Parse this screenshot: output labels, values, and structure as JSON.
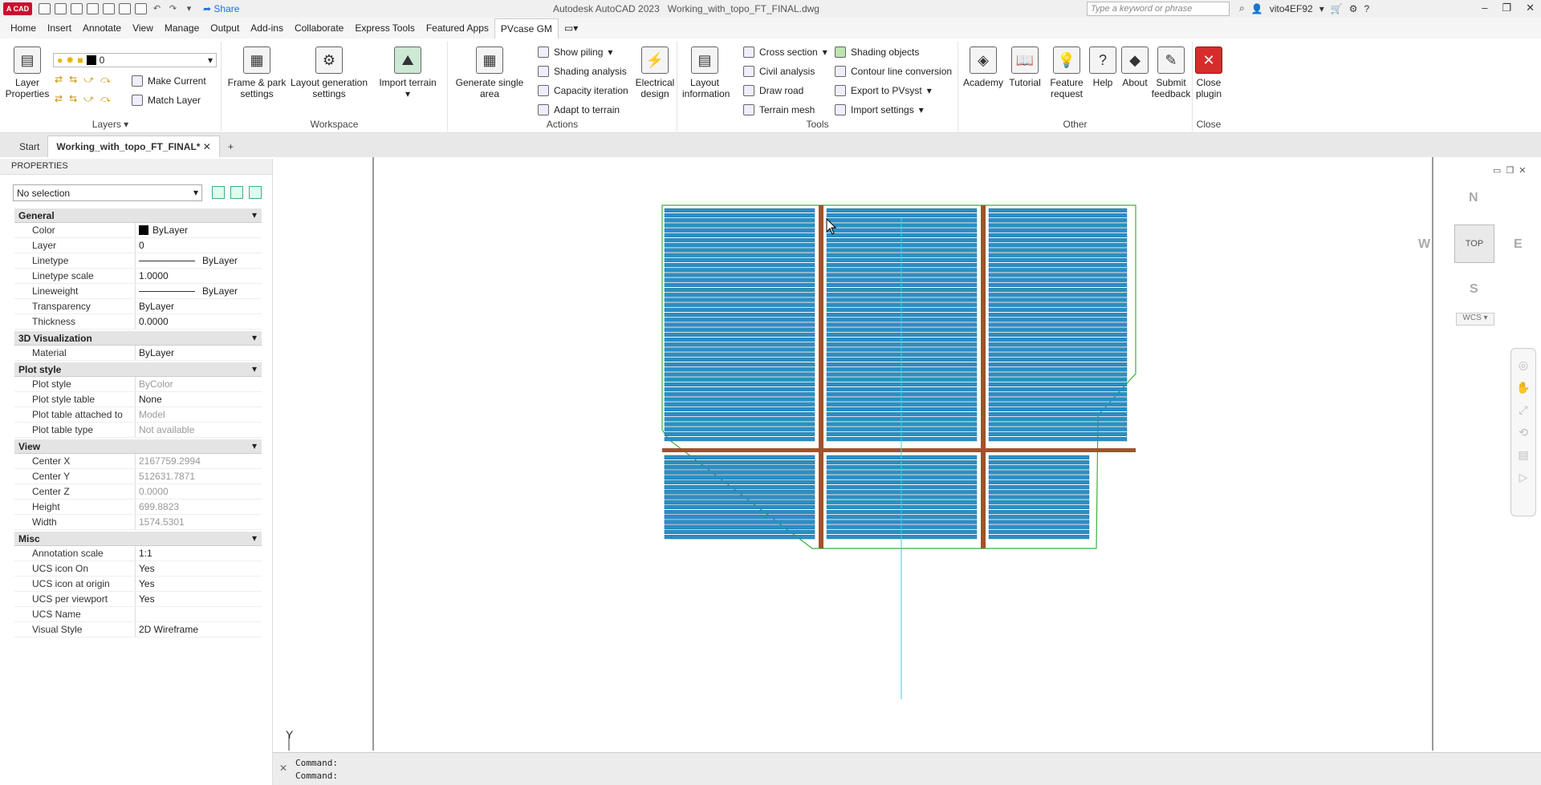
{
  "app": {
    "logo": "A CAD",
    "title": "Autodesk AutoCAD 2023",
    "filename": "Working_with_topo_FT_FINAL.dwg",
    "share_label": "Share",
    "search_placeholder": "Type a keyword or phrase",
    "user": "vito4EF92"
  },
  "menu": {
    "tabs": [
      "Home",
      "Insert",
      "Annotate",
      "View",
      "Manage",
      "Output",
      "Add-ins",
      "Collaborate",
      "Express Tools",
      "Featured Apps",
      "PVcase GM"
    ],
    "active_tab": "PVcase GM"
  },
  "ribbon": {
    "layers": {
      "title": "Layers",
      "layer_properties": "Layer Properties",
      "current_layer": "0",
      "make_current": "Make Current",
      "match_layer": "Match Layer"
    },
    "workspace": {
      "title": "Workspace",
      "frame_park": "Frame & park settings",
      "layout_generation": "Layout generation settings",
      "import_terrain": "Import terrain"
    },
    "actions": {
      "title": "Actions",
      "generate_single": "Generate single area",
      "show_piling": "Show piling",
      "shading_analysis": "Shading analysis",
      "capacity_iteration": "Capacity iteration",
      "adapt_to_terrain": "Adapt to terrain",
      "electrical_design": "Electrical design"
    },
    "tools": {
      "title": "Tools",
      "layout_information": "Layout information",
      "cross_section": "Cross section",
      "civil_analysis": "Civil analysis",
      "draw_road": "Draw road",
      "terrain_mesh": "Terrain mesh",
      "shading_objects": "Shading objects",
      "contour_conversion": "Contour line conversion",
      "export_pvsyst": "Export to PVsyst",
      "import_settings": "Import settings"
    },
    "other": {
      "title": "Other",
      "academy": "Academy",
      "tutorial": "Tutorial",
      "feature_request": "Feature request",
      "help": "Help",
      "about": "About",
      "submit_feedback": "Submit feedback"
    },
    "close": {
      "title": "Close",
      "close_plugin": "Close plugin"
    }
  },
  "doc_tabs": {
    "start": "Start",
    "active": "Working_with_topo_FT_FINAL*",
    "add": "+"
  },
  "properties": {
    "header": "PROPERTIES",
    "selection": "No selection",
    "sections": [
      {
        "title": "General",
        "rows": [
          {
            "k": "Color",
            "v": "ByLayer"
          },
          {
            "k": "Layer",
            "v": "0"
          },
          {
            "k": "Linetype",
            "v": "ByLayer"
          },
          {
            "k": "Linetype scale",
            "v": "1.0000"
          },
          {
            "k": "Lineweight",
            "v": "ByLayer"
          },
          {
            "k": "Transparency",
            "v": "ByLayer"
          },
          {
            "k": "Thickness",
            "v": "0.0000"
          }
        ]
      },
      {
        "title": "3D Visualization",
        "rows": [
          {
            "k": "Material",
            "v": "ByLayer"
          }
        ]
      },
      {
        "title": "Plot style",
        "rows": [
          {
            "k": "Plot style",
            "v": "ByColor"
          },
          {
            "k": "Plot style table",
            "v": "None"
          },
          {
            "k": "Plot table attached to",
            "v": "Model"
          },
          {
            "k": "Plot table type",
            "v": "Not available"
          }
        ]
      },
      {
        "title": "View",
        "rows": [
          {
            "k": "Center X",
            "v": "2167759.2994"
          },
          {
            "k": "Center Y",
            "v": "512631.7871"
          },
          {
            "k": "Center Z",
            "v": "0.0000"
          },
          {
            "k": "Height",
            "v": "699.8823"
          },
          {
            "k": "Width",
            "v": "1574.5301"
          }
        ]
      },
      {
        "title": "Misc",
        "rows": [
          {
            "k": "Annotation scale",
            "v": "1:1"
          },
          {
            "k": "UCS icon On",
            "v": "Yes"
          },
          {
            "k": "UCS icon at origin",
            "v": "Yes"
          },
          {
            "k": "UCS per viewport",
            "v": "Yes"
          },
          {
            "k": "UCS Name",
            "v": ""
          },
          {
            "k": "Visual Style",
            "v": "2D Wireframe"
          }
        ]
      }
    ]
  },
  "viewcube": {
    "face": "TOP",
    "north": "N",
    "south": "S",
    "east": "E",
    "west": "W",
    "wcs": "WCS"
  },
  "ucs_label": "Y",
  "command_line": [
    "Command:",
    "Command:"
  ],
  "colors": {
    "panel_fill": "#2a8fc4",
    "road": "#a0522d",
    "boundary": "#3cae3c",
    "axis": "#2dd6e0"
  }
}
